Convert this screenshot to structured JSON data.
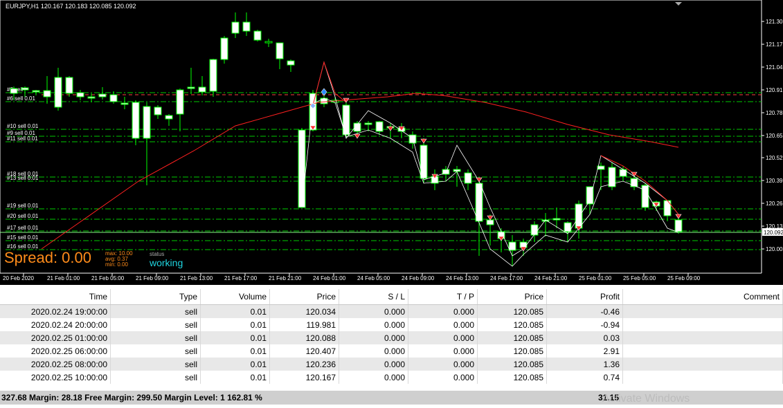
{
  "chart": {
    "symbol_line": "EURJPY,H1  120.167 120.183 120.085 120.092",
    "spread_label": "Spread: 0.00",
    "stats": {
      "max": "max: 10.00",
      "avg": "avg: 0.37",
      "min": "min: 0.00"
    },
    "status_label": "status",
    "status_value": "working",
    "current_price": "120.092",
    "price_ticks": [
      "121.30",
      "121.17",
      "121.04",
      "120.91",
      "120.78",
      "120.65",
      "120.52",
      "120.39",
      "120.26",
      "120.13",
      "120.00"
    ],
    "time_ticks": [
      "20 Feb 2020",
      "21 Feb 01:00",
      "21 Feb 05:00",
      "21 Feb 09:00",
      "21 Feb 13:00",
      "21 Feb 17:00",
      "21 Feb 21:00",
      "24 Feb 01:00",
      "24 Feb 05:00",
      "24 Feb 09:00",
      "24 Feb 13:00",
      "24 Feb 17:00",
      "24 Feb 21:00",
      "25 Feb 01:00",
      "25 Feb 05:00",
      "25 Feb 09:00"
    ],
    "order_labels": [
      "#8 sell",
      "#6 sell 0.01",
      "#10 sell 0.01",
      "#9 sell 0.01",
      "#11 sell 0.01",
      "#18 sell 0.01",
      "#13 sell 0.01",
      "#19 sell 0.01",
      "#20 sell 0.01",
      "#17 sell 0.01",
      "#15 sell 0.01",
      "#16 sell 0.01"
    ],
    "colors": {
      "bull": "#ffffff",
      "bear": "#000000",
      "wick": "#00ff00",
      "ma": "#ff2020",
      "level": "#00cc00",
      "dash_red": "#ff4040"
    }
  },
  "table": {
    "headers": [
      "Time",
      "Type",
      "Volume",
      "Price",
      "S / L",
      "T / P",
      "Price",
      "Profit",
      "Comment"
    ],
    "rows": [
      [
        "2020.02.24 19:00:00",
        "sell",
        "0.01",
        "120.034",
        "0.000",
        "0.000",
        "120.085",
        "-0.46",
        ""
      ],
      [
        "2020.02.24 20:00:00",
        "sell",
        "0.01",
        "119.981",
        "0.000",
        "0.000",
        "120.085",
        "-0.94",
        ""
      ],
      [
        "2020.02.25 01:00:00",
        "sell",
        "0.01",
        "120.088",
        "0.000",
        "0.000",
        "120.085",
        "0.03",
        ""
      ],
      [
        "2020.02.25 06:00:00",
        "sell",
        "0.01",
        "120.407",
        "0.000",
        "0.000",
        "120.085",
        "2.91",
        ""
      ],
      [
        "2020.02.25 08:00:00",
        "sell",
        "0.01",
        "120.236",
        "0.000",
        "0.000",
        "120.085",
        "1.36",
        ""
      ],
      [
        "2020.02.25 10:00:00",
        "sell",
        "0.01",
        "120.167",
        "0.000",
        "0.000",
        "120.085",
        "0.74",
        ""
      ]
    ],
    "footer": "327.68  Margin: 28.18  Free Margin: 299.50  Margin Level: 1 162.81 %",
    "footer_profit": "31.15"
  },
  "watermark": "Activate Windows"
}
